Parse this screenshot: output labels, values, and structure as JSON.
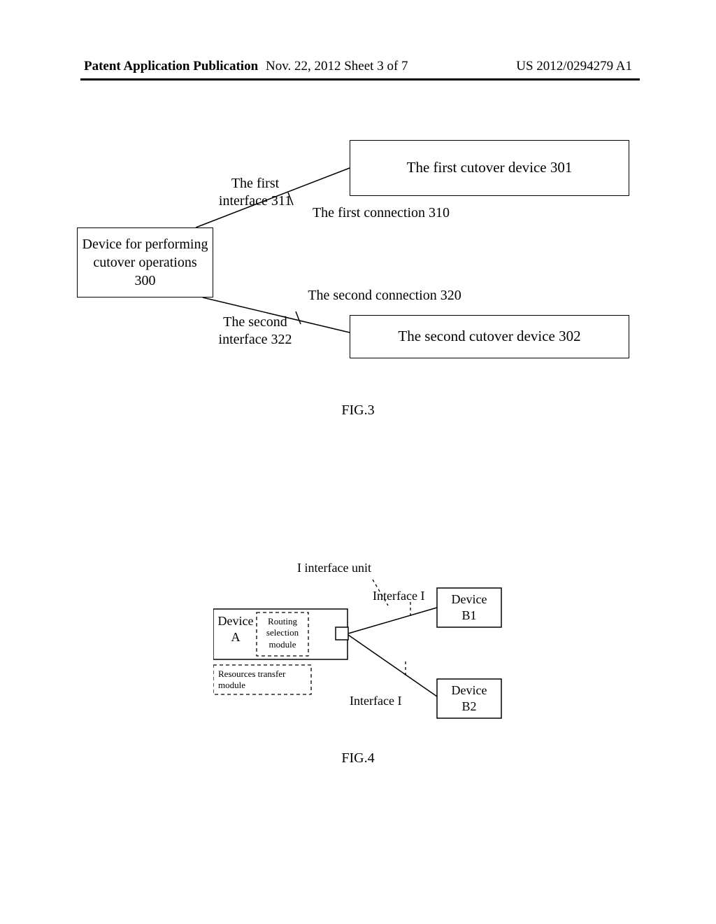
{
  "header": {
    "left": "Patent Application Publication",
    "mid": "Nov. 22, 2012  Sheet 3 of 7",
    "right": "US 2012/0294279 A1"
  },
  "fig3": {
    "device300": "Device for performing cutover operations 300",
    "device301": "The first cutover device 301",
    "device302": "The second cutover device 302",
    "interface1": "The first interface 311",
    "connection1": "The first connection 310",
    "interface2": "The second interface 322",
    "connection2": "The second connection 320",
    "caption": "FIG.3"
  },
  "fig4": {
    "iInterfaceUnit": "I interface unit",
    "interfaceI_1": "Interface I",
    "interfaceI_2": "Interface I",
    "deviceA": "Device A",
    "routing": "Routing selection module",
    "resources": "Resources transfer module",
    "deviceB1": "Device B1",
    "deviceB2": "Device B2",
    "caption": "FIG.4"
  }
}
